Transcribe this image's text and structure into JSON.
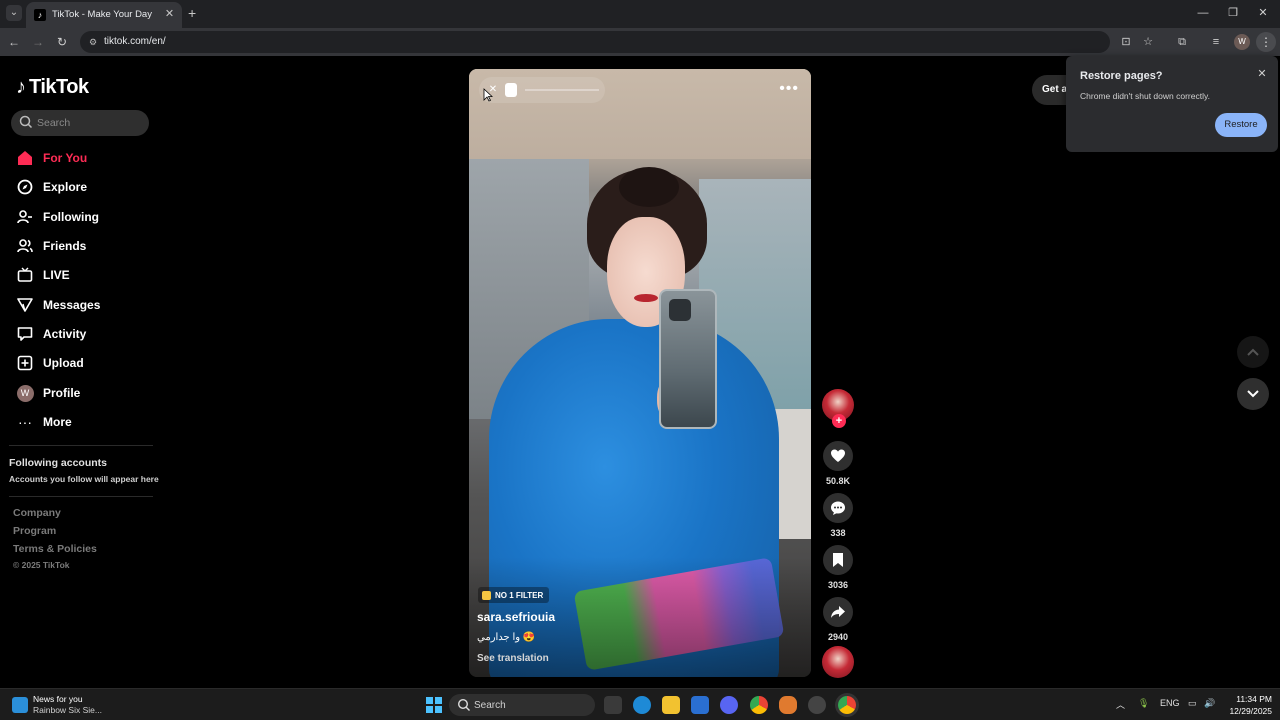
{
  "browser": {
    "tab_title": "TikTok - Make Your Day",
    "url": "tiktok.com/en/",
    "profile_initial": "W"
  },
  "sidebar": {
    "logo": "TikTok",
    "search_placeholder": "Search",
    "nav": [
      {
        "label": "For You",
        "icon": "home-icon",
        "active": true
      },
      {
        "label": "Explore",
        "icon": "compass-icon"
      },
      {
        "label": "Following",
        "icon": "following-icon"
      },
      {
        "label": "Friends",
        "icon": "friends-icon"
      },
      {
        "label": "LIVE",
        "icon": "live-icon"
      },
      {
        "label": "Messages",
        "icon": "messages-icon"
      },
      {
        "label": "Activity",
        "icon": "activity-icon"
      },
      {
        "label": "Upload",
        "icon": "upload-icon"
      },
      {
        "label": "Profile",
        "icon": "avatar",
        "initial": "W"
      },
      {
        "label": "More",
        "icon": "more-icon"
      }
    ],
    "following_title": "Following accounts",
    "following_sub": "Accounts you follow will appear here",
    "footer": [
      "Company",
      "Program",
      "Terms & Policies"
    ],
    "copyright": "© 2025 TikTok"
  },
  "video": {
    "badge": "NO 1 FILTER",
    "username": "sara.sefriouia",
    "caption": "وا جدارمي 😍",
    "see_translation": "See translation"
  },
  "actions": {
    "likes": "50.8K",
    "comments": "338",
    "saves": "3036",
    "shares": "2940"
  },
  "get_app_label": "Get app",
  "restore_popup": {
    "title": "Restore pages?",
    "message": "Chrome didn't shut down correctly.",
    "button": "Restore"
  },
  "taskbar": {
    "news_title": "News for you",
    "news_sub": "Rainbow Six Sie...",
    "search_label": "Search",
    "lang": "ENG",
    "time": "11:34 PM",
    "date": "12/29/2025"
  },
  "colors": {
    "accent": "#fe2c55",
    "restore_button": "#8ab4f8"
  }
}
